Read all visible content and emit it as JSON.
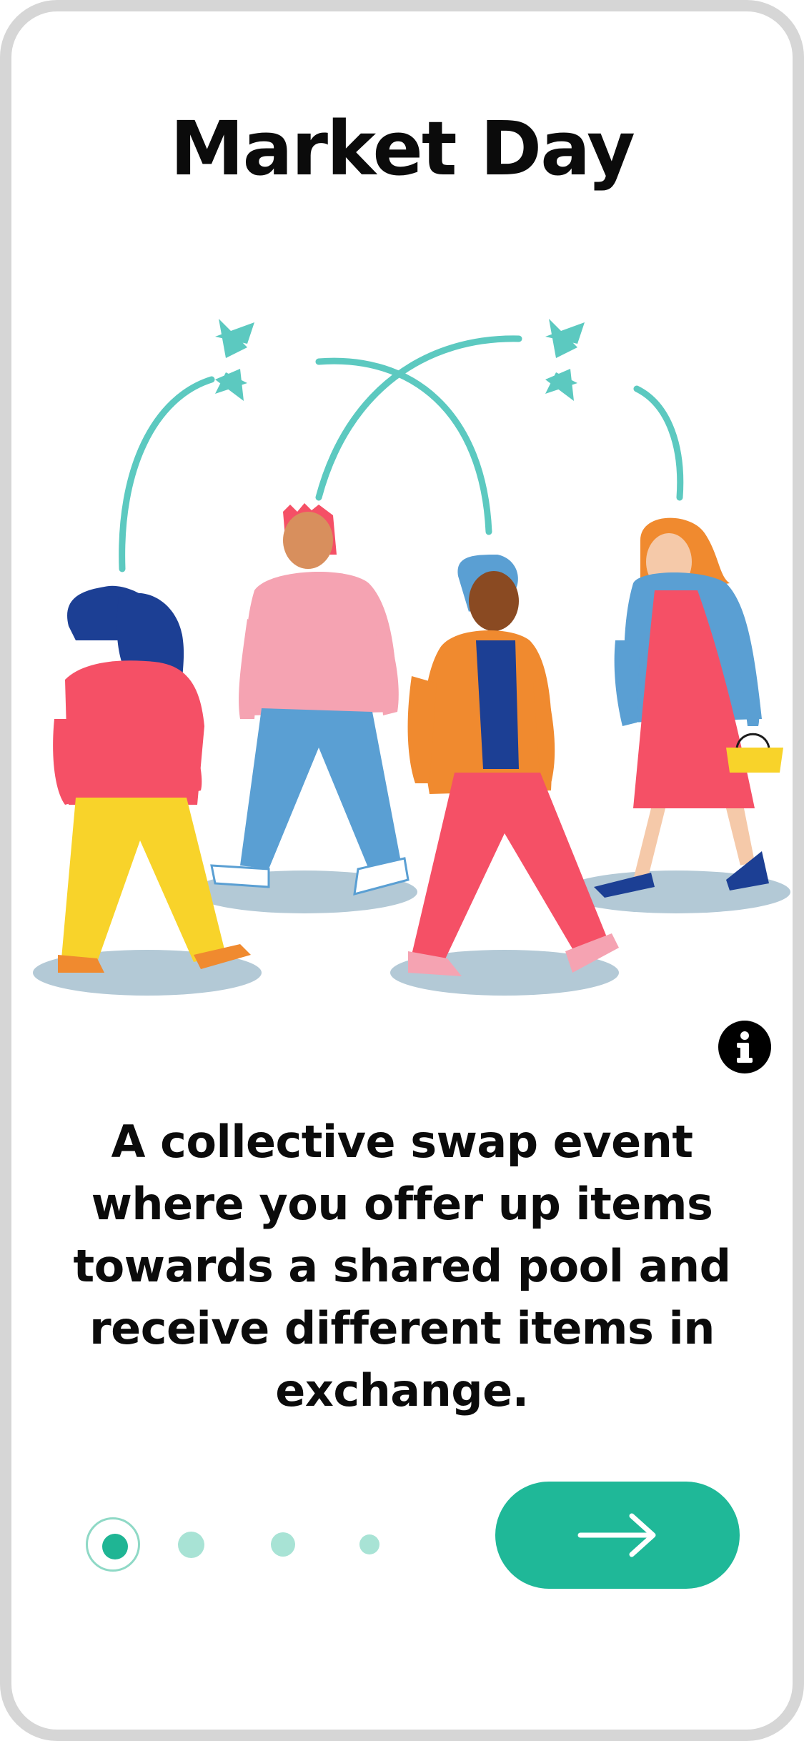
{
  "screen": {
    "title": "Market Day",
    "description": "A collective swap event where you offer up items towards a shared pool and receive different items in exchange."
  },
  "illustration": {
    "subject": "four people walking and swapping items",
    "colors": {
      "arrow": "#5cc9c0",
      "shadow": "#b3c9d6"
    }
  },
  "info_button": {
    "icon": "info-icon"
  },
  "pager": {
    "total": 4,
    "active_index": 0
  },
  "next_button": {
    "icon": "arrow-right-icon"
  },
  "colors": {
    "accent": "#1fb898",
    "dot_inactive": "#a8e3d5",
    "frame": "#d6d6d6",
    "text": "#0b0b0b"
  }
}
